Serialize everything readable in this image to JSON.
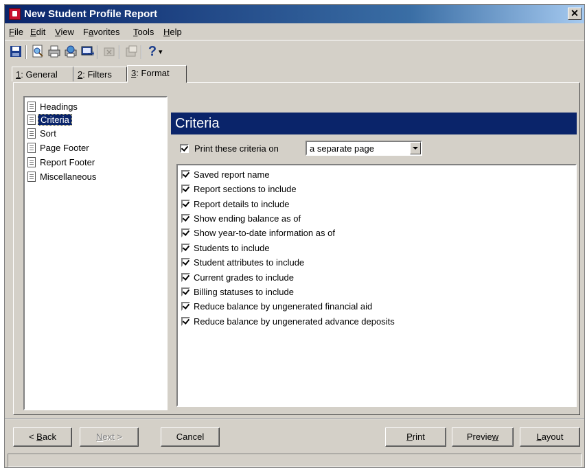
{
  "window": {
    "title": "New Student Profile Report",
    "close_label": "✕"
  },
  "menu": [
    {
      "pre": "",
      "u": "F",
      "post": "ile"
    },
    {
      "pre": "",
      "u": "E",
      "post": "dit"
    },
    {
      "pre": "",
      "u": "V",
      "post": "iew"
    },
    {
      "pre": "F",
      "u": "a",
      "post": "vorites"
    },
    {
      "pre": "",
      "u": "T",
      "post": "ools"
    },
    {
      "pre": "",
      "u": "H",
      "post": "elp"
    }
  ],
  "toolbar": {
    "icons": [
      "save-icon",
      "preview-icon",
      "print-icon",
      "print-setup-icon",
      "export-icon",
      "delete-icon",
      "properties-icon",
      "help-icon"
    ],
    "help_label": "?",
    "dropdown_label": "▾"
  },
  "tabs": [
    {
      "num": "1",
      "text": ": General"
    },
    {
      "num": "2",
      "text": ": Filters"
    },
    {
      "num": "3",
      "text": ": Format"
    }
  ],
  "nav": {
    "items": [
      "Headings",
      "Criteria",
      "Sort",
      "Page Footer",
      "Report Footer",
      "Miscellaneous"
    ],
    "selected": "Criteria"
  },
  "section": {
    "title": "Criteria",
    "print_label": "Print these criteria on",
    "print_checked": true,
    "print_option": "a separate page"
  },
  "criteria": [
    {
      "label": "Saved report name",
      "checked": true
    },
    {
      "label": "Report sections to include",
      "checked": true
    },
    {
      "label": "Report details to include",
      "checked": true
    },
    {
      "label": "Show ending balance as of",
      "checked": true
    },
    {
      "label": "Show year-to-date information as of",
      "checked": true
    },
    {
      "label": "Students to include",
      "checked": true
    },
    {
      "label": "Student attributes to include",
      "checked": true
    },
    {
      "label": "Current grades to include",
      "checked": true
    },
    {
      "label": "Billing statuses to include",
      "checked": true
    },
    {
      "label": "Reduce balance by ungenerated financial aid",
      "checked": true
    },
    {
      "label": "Reduce balance by ungenerated advance deposits",
      "checked": true
    }
  ],
  "buttons": {
    "back": {
      "pre": "< ",
      "u": "B",
      "post": "ack"
    },
    "next": {
      "pre": "",
      "u": "N",
      "post": "ext >"
    },
    "cancel": {
      "pre": "Cancel",
      "u": "",
      "post": ""
    },
    "print": {
      "pre": "",
      "u": "P",
      "post": "rint"
    },
    "preview": {
      "pre": "Previe",
      "u": "w",
      "post": ""
    },
    "layout": {
      "pre": "",
      "u": "L",
      "post": "ayout"
    }
  },
  "statusbar": {
    "text": ""
  }
}
